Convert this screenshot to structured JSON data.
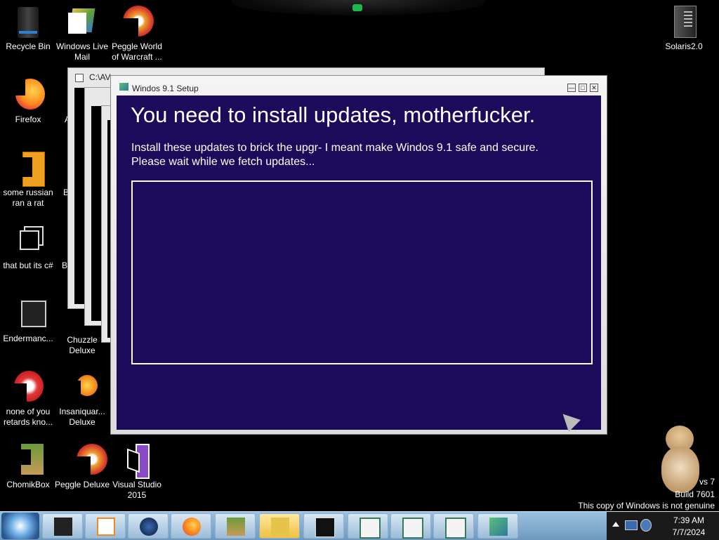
{
  "desktop": {
    "icons": [
      {
        "label": "Recycle Bin"
      },
      {
        "label": "Windows Live Mail"
      },
      {
        "label": "Peggle World of Warcraft ..."
      },
      {
        "label": "Solaris2.0"
      },
      {
        "label": "Firefox"
      },
      {
        "label": "some russian ran a rat"
      },
      {
        "label": "that but its c#"
      },
      {
        "label": "Endermanc..."
      },
      {
        "label": "Chuzzle Deluxe"
      },
      {
        "label": "none of you retards kno..."
      },
      {
        "label": "Insaniquar... Deluxe"
      },
      {
        "label": "ChomikBox"
      },
      {
        "label": "Peggle Deluxe"
      },
      {
        "label": "Visual Studio 2015"
      }
    ],
    "partial_labels": {
      "a": "A",
      "b1": "B",
      "b2": "B"
    },
    "background_window": {
      "title": "C:\\AV"
    },
    "watermark": {
      "line1": "vs 7",
      "line2": "Build 7601",
      "line3": "This copy of Windows is not genuine"
    }
  },
  "setup_window": {
    "title": "Windos 9.1 Setup",
    "heading": "You need to install updates, motherfucker.",
    "description_line1": "Install these updates to brick the upgr- I meant make Windos 9.1 safe and secure.",
    "description_line2": "Please wait while we fetch updates...",
    "buttons": {
      "minimize": "—",
      "maximize": "□",
      "close": "✕"
    }
  },
  "taskbar": {
    "start_icon": "windows-orb-icon",
    "items": [
      {
        "icon": "terminal-icon"
      },
      {
        "icon": "media-player-icon"
      },
      {
        "icon": "globe-icon"
      },
      {
        "icon": "firefox-icon"
      },
      {
        "icon": "chomikbox-icon"
      },
      {
        "icon": "folder-icon"
      },
      {
        "icon": "console-icon"
      },
      {
        "icon": "window-icon"
      },
      {
        "icon": "window-icon"
      },
      {
        "icon": "window-icon"
      },
      {
        "icon": "setup-icon"
      }
    ],
    "clock": {
      "time": "7:39 AM",
      "date": "7/7/2024"
    }
  },
  "colors": {
    "setup_bg": "#1c0a5a",
    "taskbar": "#8fb4d6"
  }
}
